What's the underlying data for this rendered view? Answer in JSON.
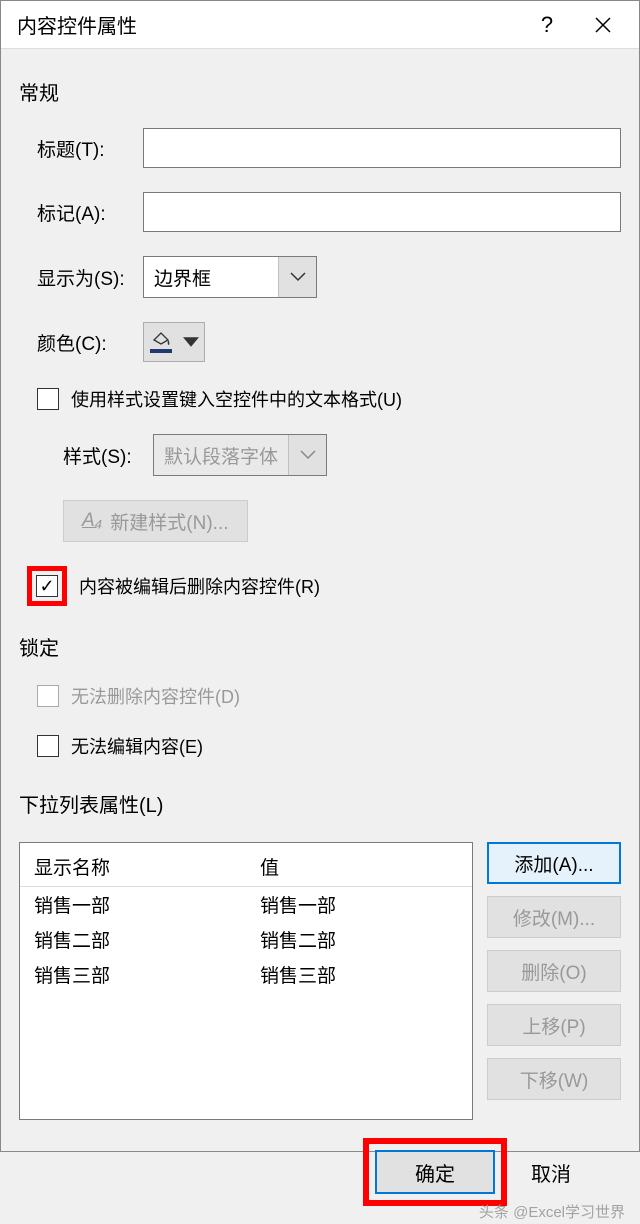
{
  "titlebar": {
    "title": "内容控件属性"
  },
  "sections": {
    "general": "常规",
    "lock": "锁定",
    "dropdown": "下拉列表属性(L)"
  },
  "fields": {
    "title_label": "标题(T):",
    "tag_label": "标记(A):",
    "showas_label": "显示为(S):",
    "showas_value": "边界框",
    "color_label": "颜色(C):",
    "style_label": "样式(S):",
    "style_value": "默认段落字体",
    "new_style_btn": "新建样式(N)..."
  },
  "checkboxes": {
    "use_style": "使用样式设置键入空控件中的文本格式(U)",
    "remove_on_edit": "内容被编辑后删除内容控件(R)",
    "cannot_delete": "无法删除内容控件(D)",
    "cannot_edit": "无法编辑内容(E)"
  },
  "list": {
    "col_display": "显示名称",
    "col_value": "值",
    "rows": [
      {
        "display": "销售一部",
        "value": "销售一部"
      },
      {
        "display": "销售二部",
        "value": "销售二部"
      },
      {
        "display": "销售三部",
        "value": "销售三部"
      }
    ]
  },
  "buttons": {
    "add": "添加(A)...",
    "modify": "修改(M)...",
    "delete": "删除(O)",
    "moveup": "上移(P)",
    "movedown": "下移(W)",
    "ok": "确定",
    "cancel": "取消"
  },
  "watermark": "头条 @Excel学习世界"
}
